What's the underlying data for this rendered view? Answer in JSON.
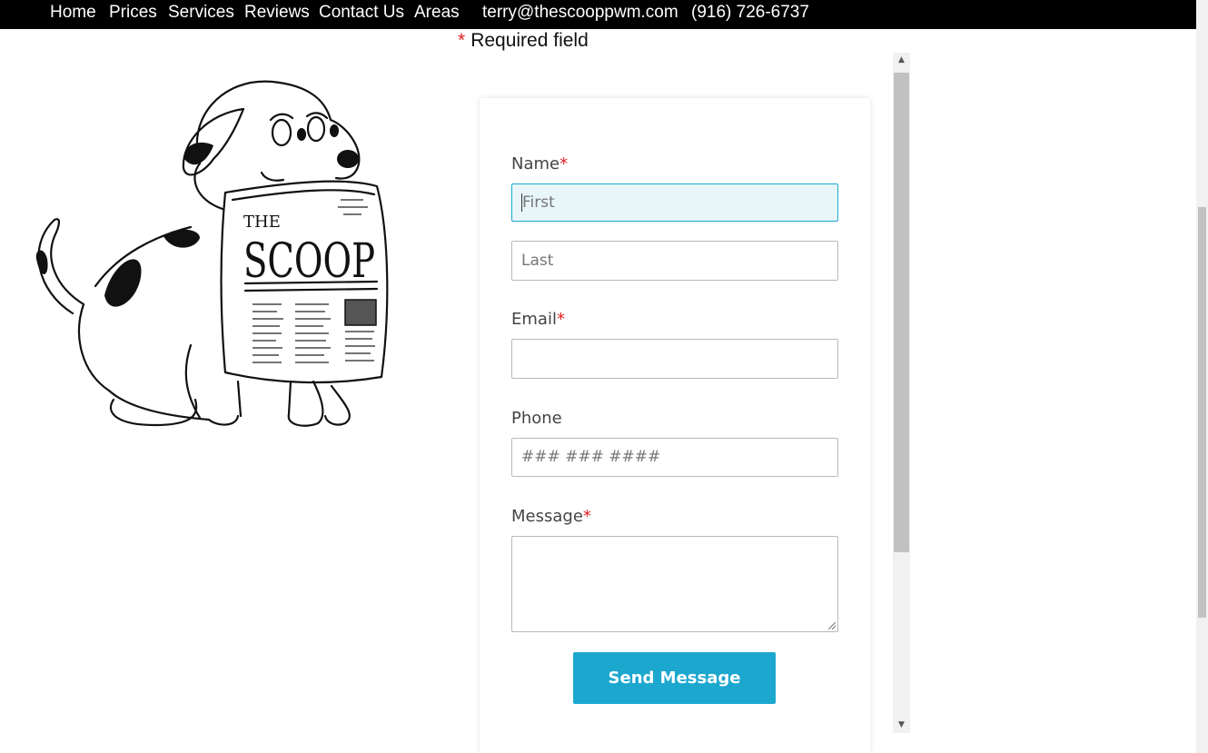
{
  "nav": {
    "items": [
      "Home",
      "Prices",
      "Services",
      "Reviews",
      "Contact Us",
      "Areas"
    ],
    "email": "terry@thescooppwm.com",
    "phone": "(916) 726-6737"
  },
  "required_note": {
    "star": "*",
    "text": "Required field"
  },
  "logo": {
    "line1": "THE",
    "line2": "SCOOP"
  },
  "form": {
    "name_label": "Name",
    "name_first_placeholder": "First",
    "name_last_placeholder": "Last",
    "email_label": "Email",
    "phone_label": "Phone",
    "phone_placeholder": "### ### ####",
    "message_label": "Message",
    "required_mark": "*",
    "submit_label": "Send Message"
  },
  "colors": {
    "accent": "#1ca7cf",
    "required": "#e02020",
    "nav_bg": "#000000"
  }
}
